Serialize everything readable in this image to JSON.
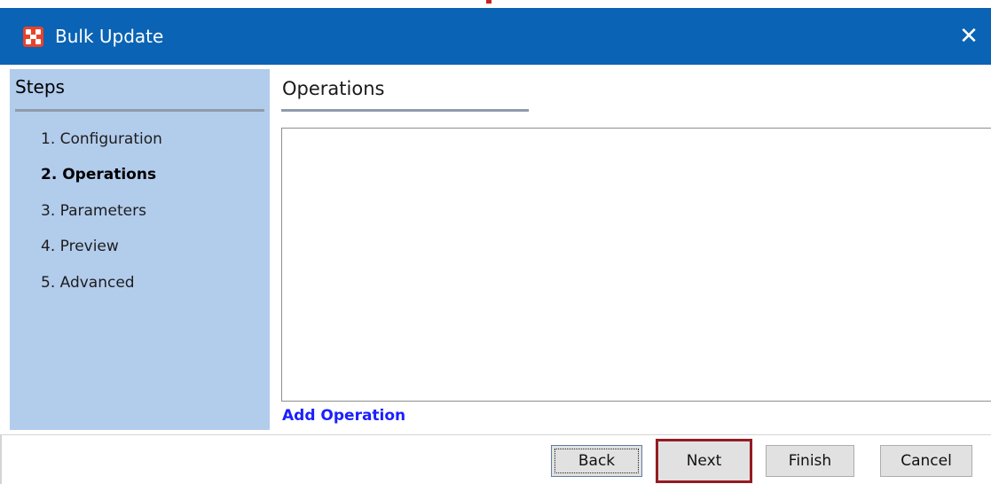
{
  "window": {
    "title": "Bulk Update",
    "icon": "app-logo-icon",
    "close_glyph": "✕"
  },
  "steps": {
    "header": "Steps",
    "items": [
      {
        "label": "1. Configuration",
        "current": false
      },
      {
        "label": "2. Operations",
        "current": true
      },
      {
        "label": "3. Parameters",
        "current": false
      },
      {
        "label": "4. Preview",
        "current": false
      },
      {
        "label": "5. Advanced",
        "current": false
      }
    ]
  },
  "main": {
    "title": "Operations",
    "add_operation_label": "Add Operation"
  },
  "buttons": {
    "back": "Back",
    "next": "Next",
    "finish": "Finish",
    "cancel": "Cancel"
  },
  "colors": {
    "titlebar": "#0a63b4",
    "steps_panel": "#b2ccec",
    "link": "#1a21ff",
    "highlight": "#951b21"
  }
}
